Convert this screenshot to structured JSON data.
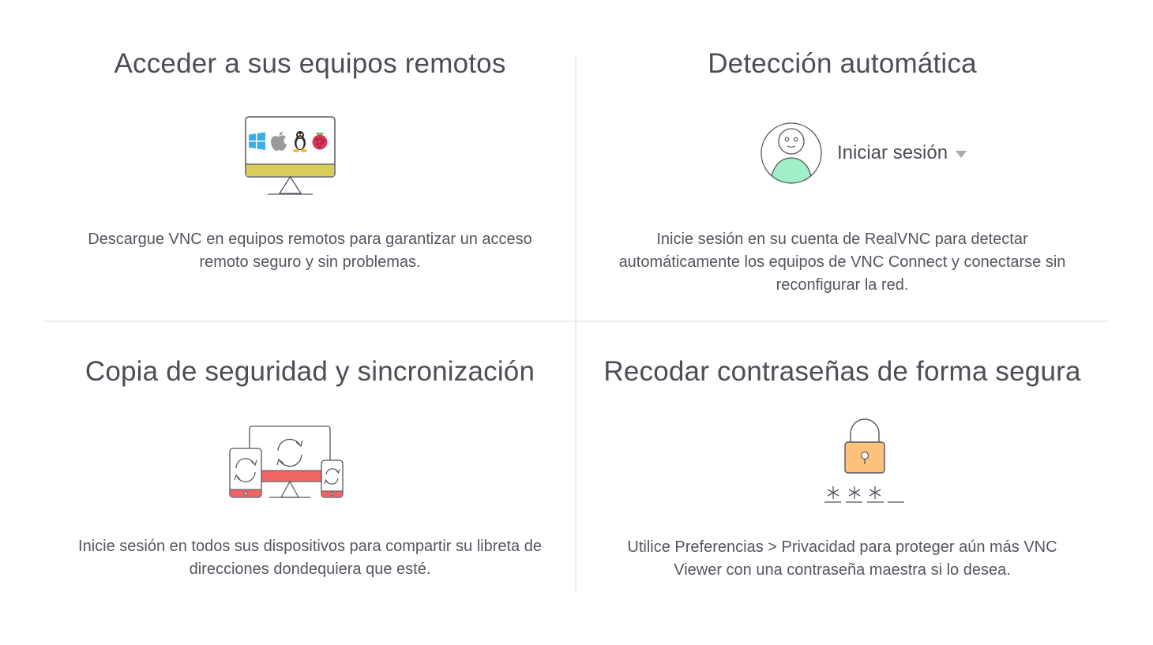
{
  "features": {
    "remote": {
      "title": "Acceder a sus equipos remotos",
      "description": "Descargue VNC en equipos remotos para garantizar un acceso remoto seguro y sin problemas.",
      "icon": "monitor-os-icons"
    },
    "discovery": {
      "title": "Detección automática",
      "description": "Inicie sesión en su cuenta de RealVNC para detectar automáticamente los equipos de VNC Connect y conectarse sin reconfigurar la red.",
      "signin_label": "Iniciar sesión",
      "icon": "user-avatar-icon"
    },
    "backup": {
      "title": "Copia de seguridad y sincronización",
      "description": "Inicie sesión en todos sus dispositivos para compartir su libreta de direcciones dondequiera que esté.",
      "icon": "devices-sync-icon"
    },
    "passwords": {
      "title": "Recodar contraseñas de forma segura",
      "description": "Utilice Preferencias > Privacidad para proteger aún más VNC Viewer con una contraseña maestra si lo desea.",
      "icon": "padlock-icon"
    }
  },
  "colors": {
    "monitor_stand_bar": "#d8cd5b",
    "avatar_body": "#9ff0c8",
    "sync_red": "#f06464",
    "lock_body": "#fdc27a",
    "windows_blue": "#3aaee8",
    "apple_grey": "#9a9a9a",
    "raspberry_red": "#d9395a"
  }
}
